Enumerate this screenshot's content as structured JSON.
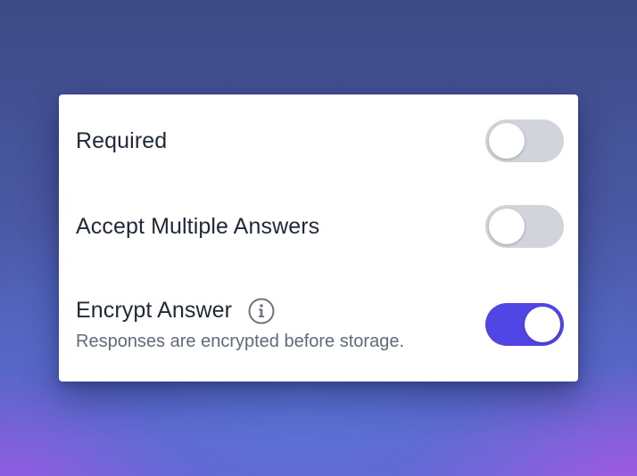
{
  "settings": [
    {
      "label": "Required",
      "enabled": false
    },
    {
      "label": "Accept Multiple Answers",
      "enabled": false
    },
    {
      "label": "Encrypt Answer",
      "description": "Responses are encrypted before storage.",
      "info_icon": "info-icon",
      "enabled": true
    }
  ],
  "colors": {
    "toggle_on": "#4f46e5",
    "toggle_off": "#d1d5db",
    "label_text": "#1f2937",
    "description_text": "#606a7b"
  }
}
